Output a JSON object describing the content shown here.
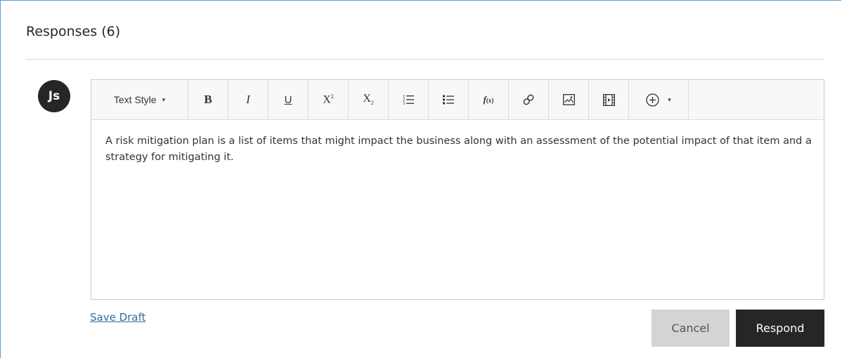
{
  "section": {
    "title": "Responses (6)"
  },
  "user": {
    "initials": "Js"
  },
  "toolbar": {
    "text_style_label": "Text Style",
    "text_style_caret": "▾",
    "insert_caret": "▾",
    "buttons": [
      {
        "name": "bold",
        "icon": "bold-icon"
      },
      {
        "name": "italic",
        "icon": "italic-icon"
      },
      {
        "name": "underline",
        "icon": "underline-icon"
      },
      {
        "name": "superscript",
        "icon": "superscript-icon"
      },
      {
        "name": "subscript",
        "icon": "subscript-icon"
      },
      {
        "name": "ordered-list",
        "icon": "ordered-list-icon"
      },
      {
        "name": "unordered-list",
        "icon": "unordered-list-icon"
      },
      {
        "name": "math-formula",
        "icon": "function-icon"
      },
      {
        "name": "insert-link",
        "icon": "link-icon"
      },
      {
        "name": "insert-image",
        "icon": "image-icon"
      },
      {
        "name": "insert-media",
        "icon": "video-icon"
      },
      {
        "name": "insert-content",
        "icon": "plus-circle-icon"
      }
    ]
  },
  "editor": {
    "content": "A risk mitigation plan is a list of items that might impact the business along with an assessment of the potential impact of that item and a strategy for mitigating it."
  },
  "actions": {
    "save_draft_label": "Save Draft",
    "cancel_label": "Cancel",
    "respond_label": "Respond"
  },
  "colors": {
    "frame_border": "#5b9bd5",
    "link": "#2e6fa1",
    "primary_button": "#262626",
    "secondary_button": "#d4d4d4"
  }
}
